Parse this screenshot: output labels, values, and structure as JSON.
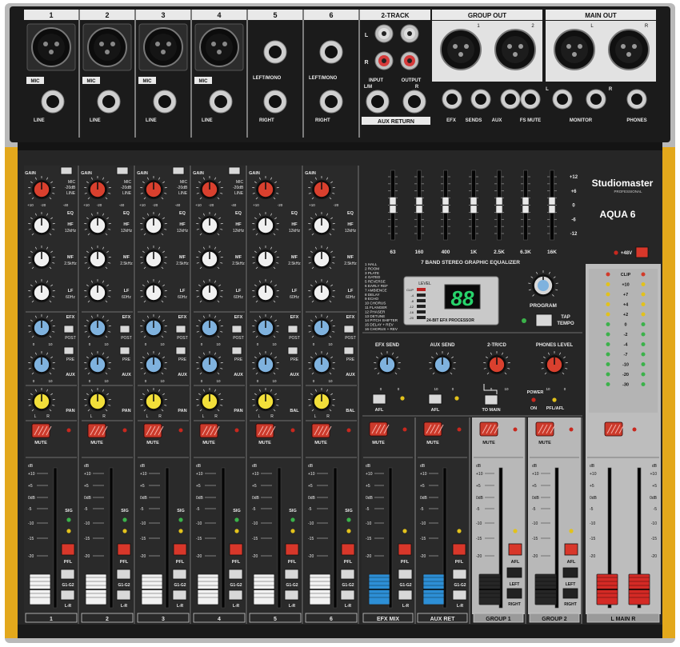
{
  "brand": {
    "name": "Studiomaster",
    "tagline": "PROFESSIONAL",
    "model": "AQUA 6"
  },
  "top_panel": {
    "channel_numbers": [
      "1",
      "2",
      "3",
      "4",
      "5",
      "6"
    ],
    "two_track": "2-TRACK",
    "group_out": "GROUP OUT",
    "main_out": "MAIN OUT",
    "mic": "MIC",
    "line": "LINE",
    "left_mono": "LEFT/MONO",
    "right": "RIGHT",
    "input": "INPUT",
    "output": "OUTPUT",
    "aux_return": "AUX RETURN",
    "l": "L",
    "r": "R",
    "l_plus": "L/M",
    "xlr_nums": [
      "1",
      "2"
    ],
    "efx": "EFX",
    "sends": "SENDS",
    "aux": "AUX",
    "fs_mute": "FS MUTE",
    "monitor": "MONITOR",
    "phones": "PHONES"
  },
  "channel_labels": {
    "gain": "GAIN",
    "mic_switch": "MIC",
    "db20": "-20dB",
    "line": "LINE",
    "gain_scale_l": "+10",
    "gain_scale_m": "-20",
    "gain_scale_r": "-40",
    "eq": "EQ",
    "hf": "HF",
    "hf_freq": "12kHz",
    "mf": "MF",
    "mf_freq": "2.5kHz",
    "lf": "LF",
    "lf_freq": "60Hz",
    "efx": "EFX",
    "post": "POST",
    "pre": "PRE",
    "aux": "AUX",
    "pan": "PAN",
    "bal": "BAL",
    "l": "L",
    "r": "R",
    "knob_min": "0",
    "knob_max": "10",
    "mute": "MUTE",
    "sig": "SIG",
    "pfl": "PFL",
    "g1g2": "G1-G2",
    "lr": "L-R"
  },
  "fader_scale": [
    "dB",
    "+10",
    "+5",
    "0dB",
    "-5",
    "-10",
    "-15",
    "-20"
  ],
  "geq": {
    "bands": [
      "63",
      "160",
      "400",
      "1K",
      "2.5K",
      "6.3K",
      "16K"
    ],
    "scale": [
      "+12",
      "+6",
      "0",
      "-6",
      "-12"
    ],
    "levels": [
      0,
      0,
      0,
      0,
      0,
      0,
      0
    ],
    "title": "7 BAND STEREO GRAPHIC EQUALIZER"
  },
  "efx": {
    "presets": [
      "1 HALL",
      "2 ROOM",
      "3 PLATE",
      "4 GATED",
      "5 REVERSE",
      "6 EARLY REF",
      "7 AMBIENCE",
      "8 DELAY",
      "9 ECHO",
      "10 CHORUS",
      "11 FLANGER",
      "12 PHASER",
      "13 DETUNE",
      "14 PITCH SHIFTER",
      "15 DELAY + REV",
      "16 CHORUS + REV"
    ],
    "display": "88",
    "level_label": "LEVEL",
    "level_marks": [
      "CLIP",
      "-4",
      "-8",
      "-12",
      "-16",
      "-20"
    ],
    "processor": "24-BIT EFX PROCESSOR",
    "program": "PROGRAM",
    "tap_tempo": "TAP TEMPO"
  },
  "master_section": {
    "efx_send": "EFX SEND",
    "aux_send": "AUX SEND",
    "two_tr_cd": "2-TR/CD",
    "phones_level": "PHONES LEVEL",
    "afl": "AFL",
    "to_main": "TO MAIN",
    "power": "POWER",
    "on": "ON",
    "pfl_afl": "PFL/AFL",
    "left": "LEFT",
    "right": "RIGHT"
  },
  "phantom": "+48V",
  "meter": {
    "labels": [
      "CLIP",
      "+10",
      "+7",
      "+4",
      "+2",
      "0",
      "-2",
      "-4",
      "-7",
      "-10",
      "-20",
      "-30"
    ]
  },
  "strip_names": [
    "1",
    "2",
    "3",
    "4",
    "5",
    "6",
    "EFX MIX",
    "AUX RET",
    "GROUP 1",
    "GROUP 2",
    "L MAIN R"
  ],
  "colors": {
    "gain": "#d9402e",
    "eq": "#f0f0f0",
    "send": "#7fb2de",
    "pan": "#f2df3a",
    "mute": "#cc3a2b",
    "efx_fader": "#2d8fd6",
    "main_fader": "#d42a25",
    "side_rail": "#e3a81c"
  }
}
